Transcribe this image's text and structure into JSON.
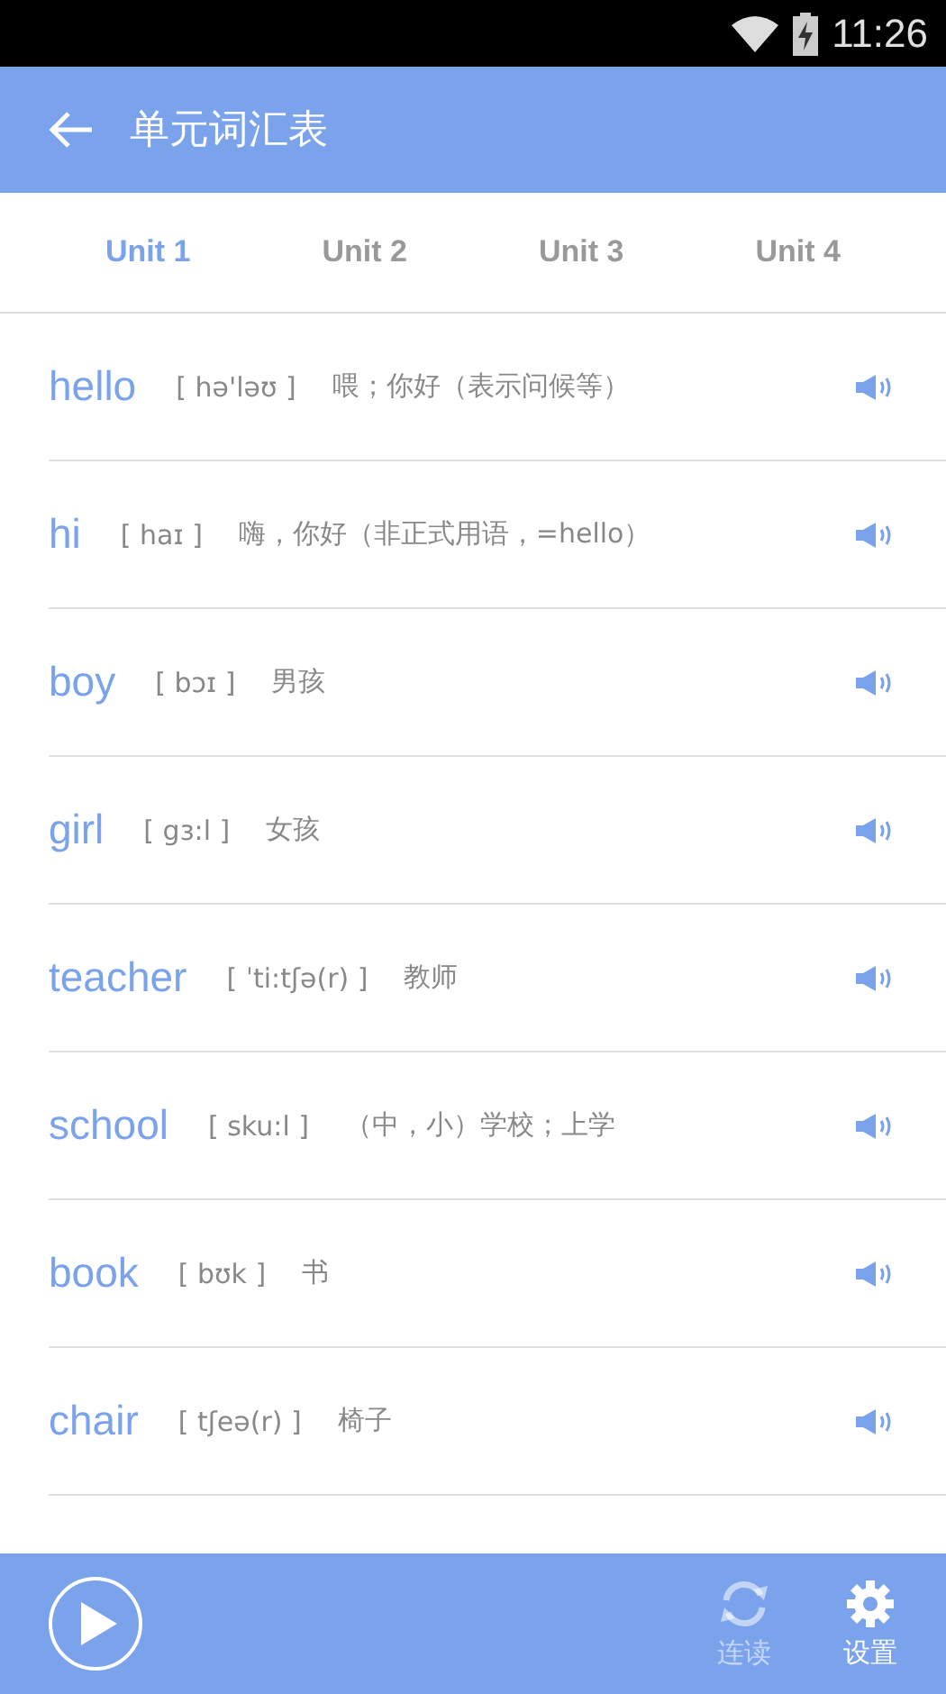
{
  "status_bar": {
    "time": "11:26"
  },
  "app_bar": {
    "title": "单元词汇表"
  },
  "tabs": [
    {
      "label": "Unit 1",
      "selected": true
    },
    {
      "label": "Unit 2",
      "selected": false
    },
    {
      "label": "Unit 3",
      "selected": false
    },
    {
      "label": "Unit 4",
      "selected": false
    }
  ],
  "words": [
    {
      "word": "hello",
      "phonetic": "[ hə'ləʊ ]",
      "meaning": "喂；你好（表示问候等）"
    },
    {
      "word": "hi",
      "phonetic": "[ haɪ ]",
      "meaning": "嗨，你好（非正式用语，=hello）"
    },
    {
      "word": "boy",
      "phonetic": "[ bɔɪ ]",
      "meaning": "男孩"
    },
    {
      "word": "girl",
      "phonetic": "[ gɜ:l ]",
      "meaning": "女孩"
    },
    {
      "word": "teacher",
      "phonetic": "[ ˈti:tʃə(r) ]",
      "meaning": "教师"
    },
    {
      "word": "school",
      "phonetic": "[ sku:l ]",
      "meaning": "（中，小）学校；上学"
    },
    {
      "word": "book",
      "phonetic": "[ bʊk ]",
      "meaning": "书"
    },
    {
      "word": "chair",
      "phonetic": "[ tʃeə(r) ]",
      "meaning": "椅子"
    }
  ],
  "bottom_bar": {
    "continuous_read": {
      "label": "连读",
      "on": false
    },
    "settings": {
      "label": "设置"
    }
  }
}
